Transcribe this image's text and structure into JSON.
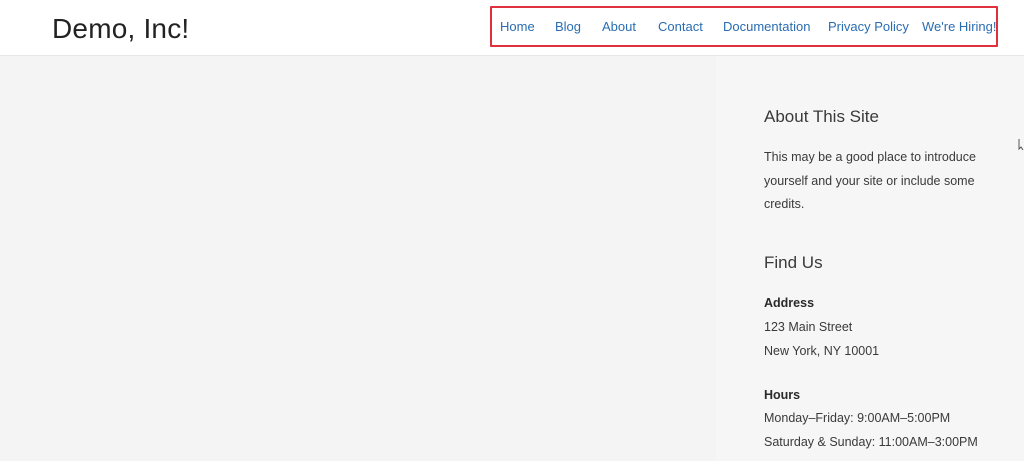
{
  "header": {
    "site_title": "Demo, Inc!"
  },
  "nav": {
    "items": [
      {
        "label": "Home"
      },
      {
        "label": "Blog"
      },
      {
        "label": "About"
      },
      {
        "label": "Contact"
      },
      {
        "label": "Documentation"
      },
      {
        "label": "Privacy Policy"
      },
      {
        "label": "We're Hiring!"
      }
    ],
    "highlight_color": "#e02f3d",
    "link_color": "#2a6db0"
  },
  "sidebar": {
    "about": {
      "title": "About This Site",
      "text_lines": [
        "This may be a good place to introduce",
        "yourself and your site or include some",
        "credits."
      ]
    },
    "find_us": {
      "title": "Find Us",
      "address_label": "Address",
      "address_line1": "123 Main Street",
      "address_line2": "New York, NY 10001",
      "hours_label": "Hours",
      "hours_line1": "Monday–Friday: 9:00AM–5:00PM",
      "hours_line2": "Saturday & Sunday: 11:00AM–3:00PM"
    }
  },
  "icons": {
    "cursor": "text-cursor-icon"
  }
}
